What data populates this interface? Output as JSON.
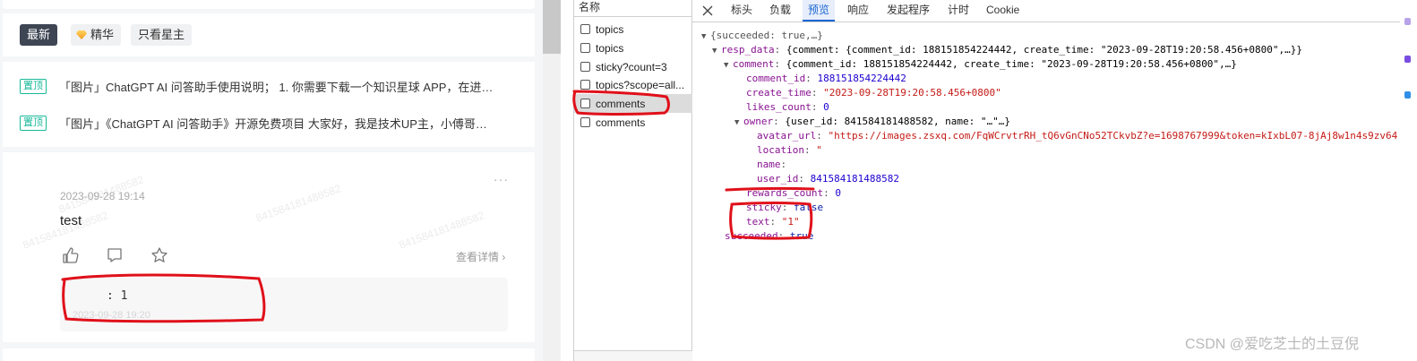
{
  "forum": {
    "filters": [
      "最新",
      "精华",
      "只看星主"
    ],
    "pinned": [
      {
        "badge": "置顶",
        "text": "「图片」ChatGPT AI 问答助手使用说明； 1. 你需要下载一个知识星球 APP，在进…"
      },
      {
        "badge": "置顶",
        "text": "「图片」《ChatGPT AI 问答助手》开源免费项目 大家好，我是技术UP主，小傅哥…"
      }
    ],
    "post": {
      "more": "···",
      "date": "2023-09-28 19:14",
      "text": "test",
      "detail_link": "查看详情",
      "comment_text": ": 1",
      "comment_time": "2023-09-28 19:20",
      "watermark": "841584181488582"
    }
  },
  "devtools": {
    "name_header": "名称",
    "requests": [
      {
        "name": "topics",
        "selected": false
      },
      {
        "name": "topics",
        "selected": false
      },
      {
        "name": "sticky?count=3",
        "selected": false
      },
      {
        "name": "topics?scope=all...",
        "selected": false
      },
      {
        "name": "comments",
        "selected": true
      },
      {
        "name": "comments",
        "selected": false
      }
    ],
    "tabs": [
      "标头",
      "负载",
      "预览",
      "响应",
      "发起程序",
      "计时",
      "Cookie"
    ],
    "active_tab": "预览",
    "preview": {
      "l1": "{succeeded: true,…}",
      "l2_key": "resp_data",
      "l2_val": "{comment: {comment_id: 188151854224442, create_time: \"2023-09-28T19:20:58.456+0800\",…}}",
      "l3_key": "comment",
      "l3_val": "{comment_id: 188151854224442, create_time: \"2023-09-28T19:20:58.456+0800\",…}",
      "comment_id_key": "comment_id",
      "comment_id_val": "188151854224442",
      "create_time_key": "create_time",
      "create_time_val": "\"2023-09-28T19:20:58.456+0800\"",
      "likes_key": "likes_count",
      "likes_val": "0",
      "owner_key": "owner",
      "owner_val": "{user_id: 841584181488582, name: \"…\"…}",
      "avatar_key": "avatar_url",
      "avatar_val": "\"https://images.zsxq.com/FqWCrvtrRH_tQ6vGnCNo52TCkvbZ?e=1698767999&token=kIxbL07-8jAj8w1n4s9zv64",
      "location_key": "location",
      "location_val": "\"",
      "name_key": "name",
      "name_val": "",
      "user_id_key": "user_id",
      "user_id_val": "841584181488582",
      "rewards_key": "rewards_count",
      "rewards_val": "0",
      "sticky_key": "sticky",
      "sticky_val": "false",
      "text_key": "text",
      "text_val": "\"1\"",
      "succeeded_key": "succeeded",
      "succeeded_val": "true"
    },
    "watermark": "CSDN @爱吃芝士的土豆倪"
  },
  "colors": {
    "accent": "#1a66d2",
    "pin_badge": "#16b998",
    "red_mark": "#e0101a",
    "key_purple": "#881391",
    "string_red": "#c41a16",
    "number_blue": "#1c00cf"
  }
}
